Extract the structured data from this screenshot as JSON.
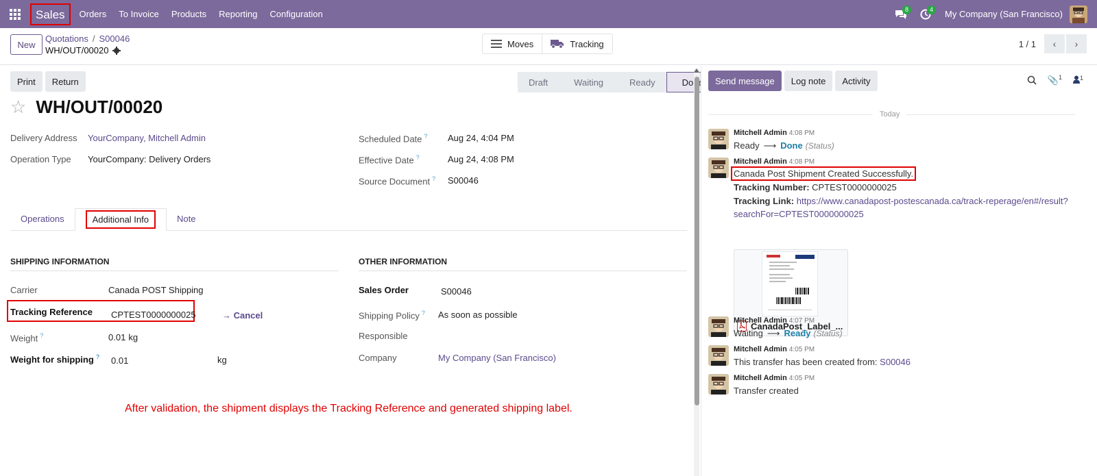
{
  "navbar": {
    "app_name": "Sales",
    "menu": [
      "Orders",
      "To Invoice",
      "Products",
      "Reporting",
      "Configuration"
    ],
    "messages_count": "8",
    "activities_count": "4",
    "company": "My Company (San Francisco)"
  },
  "control_panel": {
    "new_label": "New",
    "breadcrumb": [
      "Quotations",
      "S00046"
    ],
    "record_name": "WH/OUT/00020",
    "smart_buttons": {
      "moves": "Moves",
      "tracking": "Tracking"
    },
    "pager": "1 / 1"
  },
  "form": {
    "buttons": {
      "print": "Print",
      "return": "Return"
    },
    "statuses": [
      "Draft",
      "Waiting",
      "Ready",
      "Done"
    ],
    "current_status": "Done",
    "title": "WH/OUT/00020",
    "delivery_address_label": "Delivery Address",
    "delivery_address": "YourCompany, Mitchell Admin",
    "operation_type_label": "Operation Type",
    "operation_type": "YourCompany: Delivery Orders",
    "scheduled_date_label": "Scheduled Date",
    "scheduled_date": "Aug 24, 4:04 PM",
    "effective_date_label": "Effective Date",
    "effective_date": "Aug 24, 4:08 PM",
    "source_document_label": "Source Document",
    "source_document": "S00046",
    "tabs": [
      "Operations",
      "Additional Info",
      "Note"
    ],
    "shipping_section": "SHIPPING INFORMATION",
    "carrier_label": "Carrier",
    "carrier": "Canada POST Shipping",
    "tracking_ref_label": "Tracking Reference",
    "tracking_ref": "CPTEST0000000025",
    "cancel_label": "Cancel",
    "weight_label": "Weight",
    "weight": "0.01",
    "weight_unit": "kg",
    "weight_shipping_label": "Weight for shipping",
    "weight_shipping": "0.01",
    "weight_shipping_unit": "kg",
    "other_section": "OTHER INFORMATION",
    "sales_order_label": "Sales Order",
    "sales_order": "S00046",
    "shipping_policy_label": "Shipping Policy",
    "shipping_policy": "As soon as possible",
    "responsible_label": "Responsible",
    "company_label": "Company",
    "company": "My Company (San Francisco)",
    "annotation": "After validation, the shipment displays the Tracking Reference and generated shipping label."
  },
  "chatter": {
    "send_message": "Send message",
    "log_note": "Log note",
    "activity": "Activity",
    "attachments_count": "1",
    "followers_count": "1",
    "today": "Today",
    "messages": [
      {
        "author": "Mitchell Admin",
        "time": "4:08 PM",
        "old": "Ready",
        "new": "Done",
        "tag": "(Status)"
      },
      {
        "author": "Mitchell Admin",
        "time": "4:08 PM",
        "line1": "Canada Post Shipment Created Successfully.",
        "tracking_number_label": "Tracking Number:",
        "tracking_number": "CPTEST0000000025",
        "tracking_link_label": "Tracking Link:",
        "tracking_link_1": "https://www.canadapost-postescanada.ca/track-reperage/en#/result?",
        "tracking_link_2": "searchFor=CPTEST0000000025",
        "attachment": "CanadaPost_Label_..."
      },
      {
        "author": "Mitchell Admin",
        "time": "4:07 PM",
        "old": "Waiting",
        "new": "Ready",
        "tag": "(Status)"
      },
      {
        "author": "Mitchell Admin",
        "time": "4:05 PM",
        "text": "This transfer has been created from:",
        "link": "S00046"
      },
      {
        "author": "Mitchell Admin",
        "time": "4:05 PM",
        "text": "Transfer created"
      }
    ]
  }
}
